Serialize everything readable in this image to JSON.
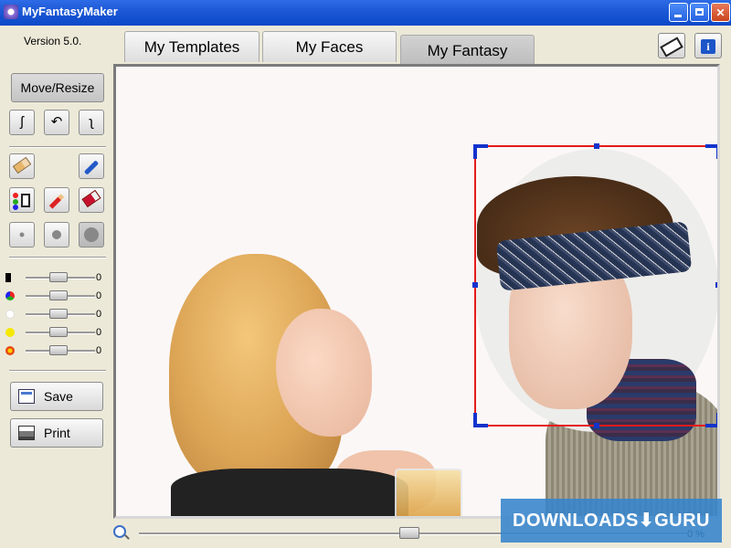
{
  "window": {
    "title": "MyFantasyMaker",
    "minimize": "_",
    "maximize": "□",
    "close": "✕"
  },
  "sidebar": {
    "version": "Version 5.0.",
    "move_resize_label": "Move/Resize",
    "rotate_buttons": [
      "ʃ",
      "↶",
      "ʅ"
    ],
    "tool_icons": [
      "eraser-icon",
      "eyedropper-icon",
      "color-picker-icon",
      "pencil-icon",
      "rubber-icon"
    ],
    "brush_sizes": [
      "small",
      "medium",
      "large"
    ],
    "sliders": [
      {
        "icon": "contrast-icon",
        "value": "0",
        "level": 0.5
      },
      {
        "icon": "color-balance-icon",
        "value": "0",
        "level": 0.5
      },
      {
        "icon": "brightness-icon",
        "value": "0",
        "level": 0.5
      },
      {
        "icon": "yellow-icon",
        "value": "0",
        "level": 0.5
      },
      {
        "icon": "red-icon",
        "value": "0",
        "level": 0.5
      }
    ],
    "save_label": "Save",
    "print_label": "Print"
  },
  "tabs": [
    {
      "label": "My Templates",
      "active": false
    },
    {
      "label": "My Faces",
      "active": false
    },
    {
      "label": "My Fantasy",
      "active": true
    }
  ],
  "toolbar_right": {
    "eraser_icon": "eraser-icon",
    "info_icon": "i"
  },
  "canvas": {
    "selection_color": "#e41b1b",
    "handle_color": "#1133cc"
  },
  "zoom": {
    "value": "0 %",
    "level": 0.5
  },
  "watermark": {
    "text": "DOWNLOADS⬇GURU"
  },
  "colors": {
    "titlebar": "#0A48C8",
    "panel": "#ECE9D8",
    "accent": "#1d55c8"
  }
}
